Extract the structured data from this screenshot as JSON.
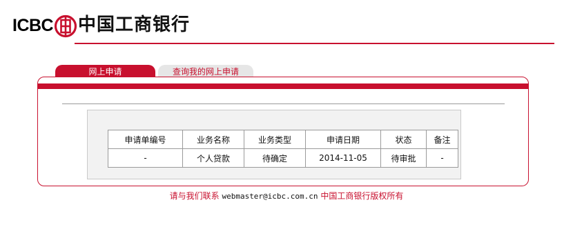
{
  "header": {
    "logo_text": "ICBC",
    "logo_icon": "icbc-seal-icon",
    "bank_name": "中国工商银行",
    "accent_color": "#c8102e"
  },
  "tabs": [
    {
      "label": "网上申请",
      "active": true
    },
    {
      "label": "查询我的网上申请",
      "active": false
    }
  ],
  "table": {
    "headers": [
      "申请单编号",
      "业务名称",
      "业务类型",
      "申请日期",
      "状态",
      "备注"
    ],
    "rows": [
      [
        "-",
        "个人贷款",
        "待确定",
        "2014-11-05",
        "待审批",
        "-"
      ]
    ]
  },
  "footer": {
    "contact_label": "请与我们联系",
    "email": "webmaster@icbc.com.cn",
    "copyright": "中国工商银行版权所有"
  }
}
